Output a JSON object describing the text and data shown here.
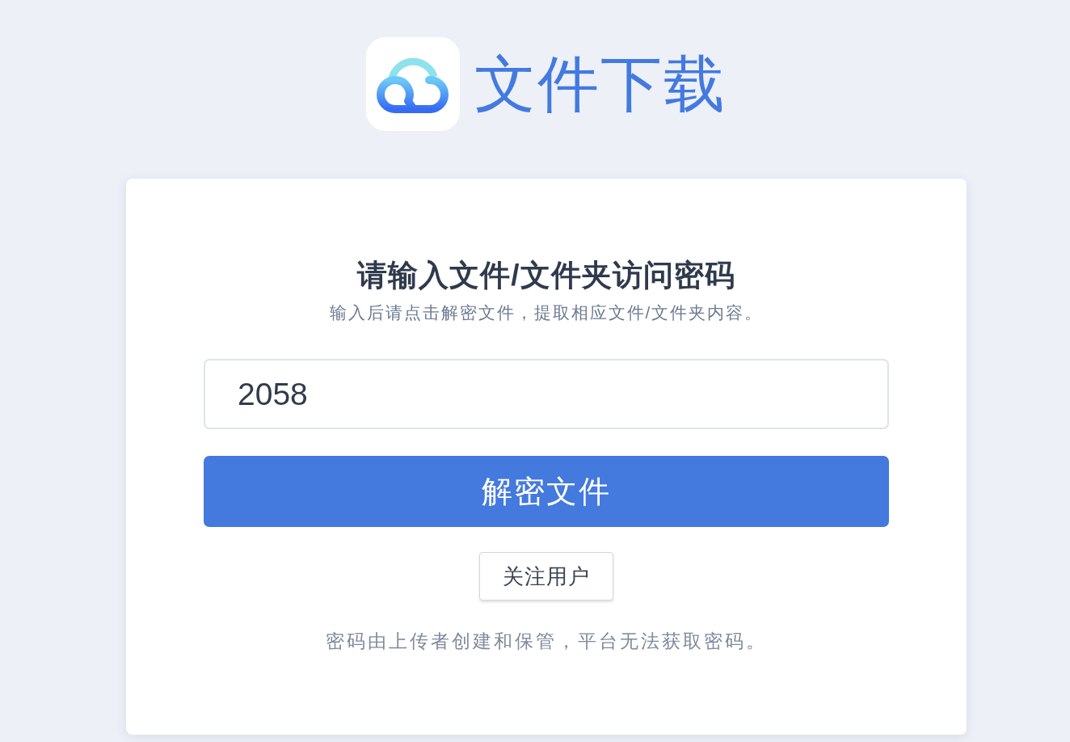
{
  "header": {
    "title": "文件下载"
  },
  "card": {
    "heading": "请输入文件/文件夹访问密码",
    "subtitle": "输入后请点击解密文件，提取相应文件/文件夹内容。",
    "password_field": {
      "value": "2058"
    },
    "decrypt_button": {
      "label": "解密文件"
    },
    "follow_button": {
      "label": "关注用户"
    },
    "footnote": "密码由上传者创建和保管，平台无法获取密码。"
  }
}
